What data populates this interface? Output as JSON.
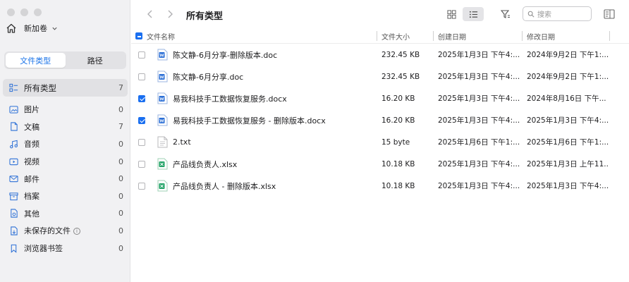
{
  "window": {
    "title": "所有类型"
  },
  "sidebar": {
    "volume": "新加卷",
    "tabs": [
      "文件类型",
      "路径"
    ],
    "selected": {
      "label": "所有类型",
      "count": "7"
    },
    "items": [
      {
        "label": "图片",
        "count": "0",
        "icon": "image-icon"
      },
      {
        "label": "文稿",
        "count": "7",
        "icon": "document-icon"
      },
      {
        "label": "音频",
        "count": "0",
        "icon": "music-icon"
      },
      {
        "label": "视频",
        "count": "0",
        "icon": "video-icon"
      },
      {
        "label": "邮件",
        "count": "0",
        "icon": "mail-icon"
      },
      {
        "label": "档案",
        "count": "0",
        "icon": "archive-icon"
      },
      {
        "label": "其他",
        "count": "0",
        "icon": "other-icon"
      },
      {
        "label": "未保存的文件",
        "count": "0",
        "icon": "unsaved-icon"
      },
      {
        "label": "浏览器书签",
        "count": "0",
        "icon": "bookmark-icon"
      }
    ]
  },
  "toolbar": {
    "search_placeholder": "搜索"
  },
  "table": {
    "headers": {
      "name": "文件名称",
      "size": "文件大小",
      "created": "创建日期",
      "modified": "修改日期"
    },
    "rows": [
      {
        "checked": false,
        "type": "word",
        "name": "陈文静-6月分享-删除版本.doc",
        "size": "232.45 KB",
        "created": "2025年1月3日 下午4:...",
        "modified": "2024年9月2日 下午1:..."
      },
      {
        "checked": false,
        "type": "word",
        "name": "陈文静-6月分享.doc",
        "size": "232.45 KB",
        "created": "2025年1月3日 下午4:...",
        "modified": "2024年9月2日 下午1:..."
      },
      {
        "checked": true,
        "type": "word",
        "name": "易我科技手工数据恢复服务.docx",
        "size": "16.20 KB",
        "created": "2025年1月3日 下午4:...",
        "modified": "2024年8月16日 下午..."
      },
      {
        "checked": true,
        "type": "word",
        "name": "易我科技手工数据恢复服务 - 删除版本.docx",
        "size": "16.20 KB",
        "created": "2025年1月3日 下午4:...",
        "modified": "2025年1月3日 下午4:..."
      },
      {
        "checked": false,
        "type": "txt",
        "name": "2.txt",
        "size": "15 byte",
        "created": "2025年1月6日 下午1:...",
        "modified": "2025年1月6日 下午1:..."
      },
      {
        "checked": false,
        "type": "excel",
        "name": "产品线负责人.xlsx",
        "size": "10.18 KB",
        "created": "2025年1月3日 下午4:...",
        "modified": "2025年1月3日 上午11..."
      },
      {
        "checked": false,
        "type": "excel",
        "name": "产品线负责人 - 删除版本.xlsx",
        "size": "10.18 KB",
        "created": "2025年1月3日 下午4:...",
        "modified": "2025年1月3日 下午4:..."
      }
    ]
  },
  "colors": {
    "accent": "#1a73e8",
    "word": "#2b6fd6",
    "excel": "#21a366"
  }
}
